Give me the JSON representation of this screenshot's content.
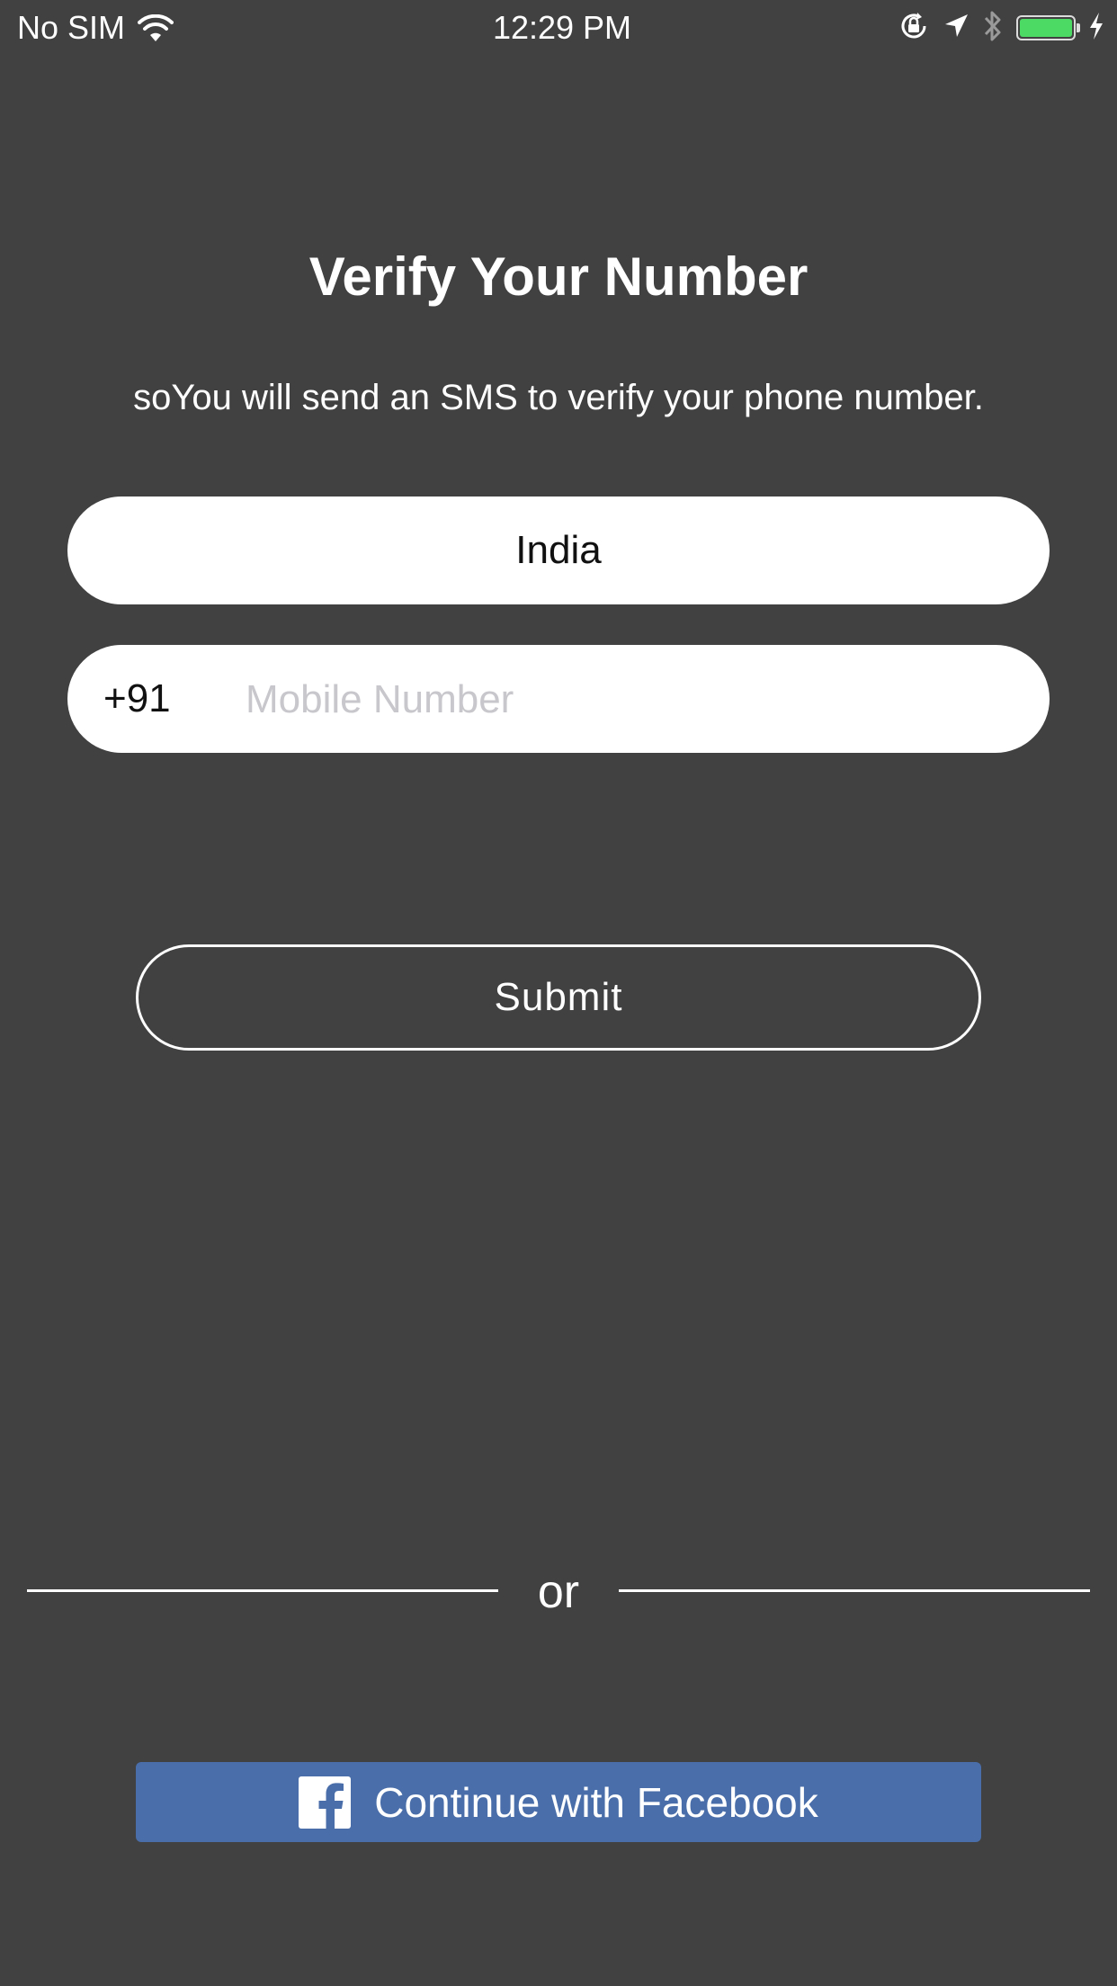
{
  "status_bar": {
    "carrier": "No SIM",
    "time": "12:29 PM",
    "icons": [
      "wifi-icon",
      "orientation-lock-icon",
      "location-arrow-icon",
      "bluetooth-icon",
      "battery-icon",
      "charging-bolt-icon"
    ],
    "battery_fill": 1.0,
    "battery_color": "#4cd964"
  },
  "main": {
    "title": "Verify Your Number",
    "subtitle": "soYou will send an SMS to verify your phone number.",
    "country": "India",
    "country_code": "+91",
    "mobile_placeholder": "Mobile Number",
    "submit_label": "Submit",
    "divider_text": "or",
    "facebook_label": "Continue with Facebook"
  },
  "colors": {
    "background": "#414141",
    "facebook_blue": "#4a6ea9",
    "placeholder": "#c7c7cc"
  }
}
